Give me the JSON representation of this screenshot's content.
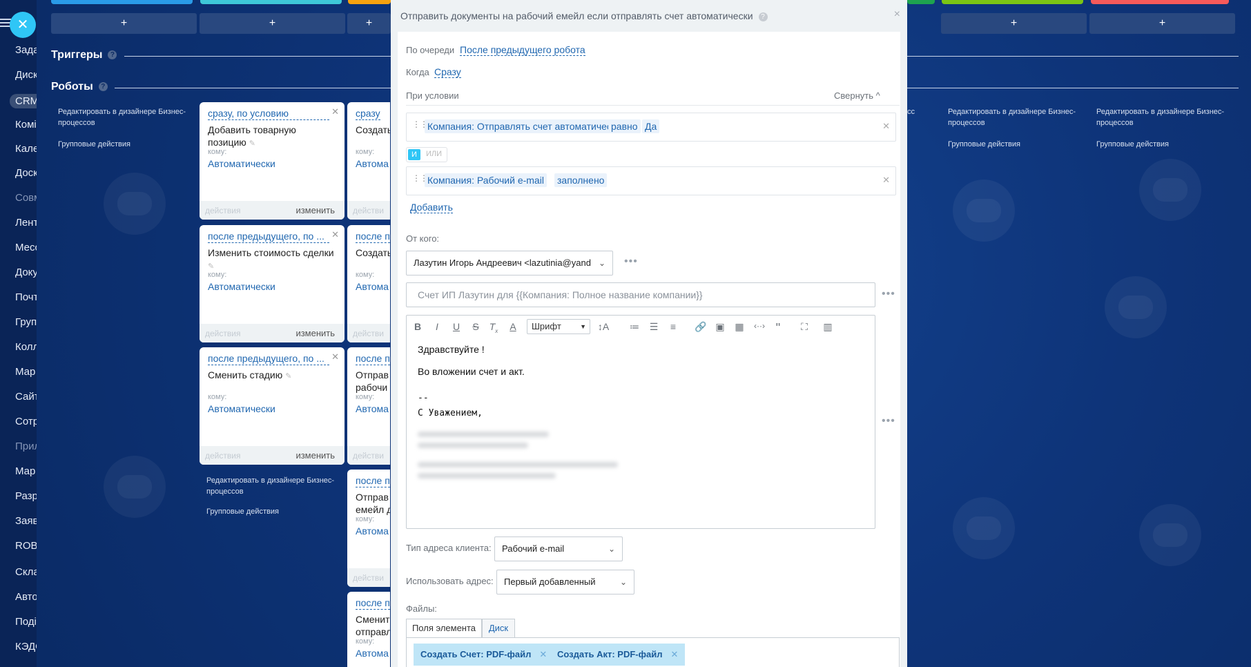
{
  "background": {
    "accent": "#0e3479",
    "primary": "#2fc6f6"
  },
  "leftnav": {
    "close_icon": "close-icon",
    "items": [
      {
        "label": "Зада",
        "dim": false
      },
      {
        "label": "Диск",
        "dim": false
      },
      {
        "label": "CRM",
        "dim": false
      },
      {
        "label": "Комі",
        "dim": false
      },
      {
        "label": "Кале",
        "dim": false
      },
      {
        "label": "Доск",
        "dim": false
      },
      {
        "label": "Совм",
        "dim": true
      },
      {
        "label": "Лент",
        "dim": false
      },
      {
        "label": "Месс",
        "dim": false
      },
      {
        "label": "Доку",
        "dim": false
      },
      {
        "label": "Почт",
        "dim": false
      },
      {
        "label": "Груп",
        "dim": false
      },
      {
        "label": "Колл",
        "dim": false
      },
      {
        "label": "Мар",
        "dim": false
      },
      {
        "label": "Сайт",
        "dim": false
      },
      {
        "label": "Сотр",
        "dim": false
      },
      {
        "label": "Прил",
        "dim": true
      },
      {
        "label": "Мар",
        "dim": false
      },
      {
        "label": "Разр",
        "dim": false
      },
      {
        "label": "Заяв",
        "dim": false
      },
      {
        "label": "ROB",
        "dim": false
      },
      {
        "label": "Скла",
        "dim": false
      },
      {
        "label": "Авто",
        "dim": false
      },
      {
        "label": "Поді",
        "dim": false
      },
      {
        "label": "КЭДО",
        "dim": false
      }
    ]
  },
  "board": {
    "plus_label": "+",
    "triggers_label": "Триггеры",
    "robots_label": "Роботы",
    "edit_in_designer": "Редактировать в дизайнере Бизнес-процессов",
    "group_actions": "Групповые действия",
    "help": "?"
  },
  "cards": [
    {
      "title": "сразу, по условию",
      "name": "Добавить товарную позицию",
      "to_label": "кому:",
      "to_value": "Автоматически",
      "actions": "действия",
      "change": "изменить"
    },
    {
      "title": "после предыдущего, по ...",
      "name": "Изменить стоимость сделки",
      "to_label": "кому:",
      "to_value": "Автоматически",
      "actions": "действия",
      "change": "изменить"
    },
    {
      "title": "после предыдущего, по ...",
      "name": "Сменить стадию",
      "to_label": "кому:",
      "to_value": "Автоматически",
      "actions": "действия",
      "change": "изменить"
    }
  ],
  "partial_cards": [
    {
      "title": "сразу",
      "name1": "Создать",
      "name2": "",
      "to_label": "кому:",
      "to_value": "Автома",
      "actions": "действи"
    },
    {
      "title": "после п",
      "name1": "Создать",
      "name2": "",
      "to_label": "кому:",
      "to_value": "Автома",
      "actions": "действи"
    },
    {
      "title": "после п",
      "name1": "Отправ",
      "name2": "рабочи",
      "to_label": "кому:",
      "to_value": "Автома",
      "actions": "действи"
    },
    {
      "title": "после п",
      "name1": "Отправ",
      "name2": "емейл д",
      "to_label": "кому:",
      "to_value": "Автома",
      "actions": "действи"
    },
    {
      "title": "после п",
      "name1": "Сменит",
      "name2": "отправл",
      "to_label": "кому:",
      "to_value": "Автома",
      "actions": ""
    }
  ],
  "modal": {
    "title": "Отправить документы на рабочий емейл если отправлять счет автоматически",
    "help": "?",
    "close": "×",
    "order_label": "По очереди",
    "order_value": "После предыдущего робота",
    "when_label": "Когда",
    "when_value": "Сразу",
    "condition_label": "При условии",
    "collapse_label": "Свернуть",
    "conditions": [
      {
        "field": "Компания: Отправлять счет автоматически",
        "op": "равно",
        "value": "Да"
      },
      {
        "field": "Компания: Рабочий e-mail",
        "op": "заполнено",
        "value": ""
      }
    ],
    "and_label": "И",
    "or_label": "ИЛИ",
    "add_label": "Добавить",
    "from_label": "От кого:",
    "from_value": "Лазутин Игорь Андреевич <lazutinia@yand",
    "subject_placeholder": "Счет ИП Лазутин для {{Компания: Полное название компании}}",
    "font_label": "Шрифт",
    "body": {
      "line1": "Здравствуйте !",
      "line2": "Во вложении счет и акт.",
      "sig_dash": "--",
      "sig_regards": "С Уважением,"
    },
    "address_type_label": "Тип адреса клиента:",
    "address_type_value": "Рабочий e-mail",
    "use_address_label": "Использовать адрес:",
    "use_address_value": "Первый добавленный",
    "files_label": "Файлы:",
    "tab_fields": "Поля элемента",
    "tab_disk": "Диск",
    "files": [
      {
        "label": "Создать Счет: PDF-файл"
      },
      {
        "label": "Создать Акт: PDF-файл"
      }
    ]
  }
}
